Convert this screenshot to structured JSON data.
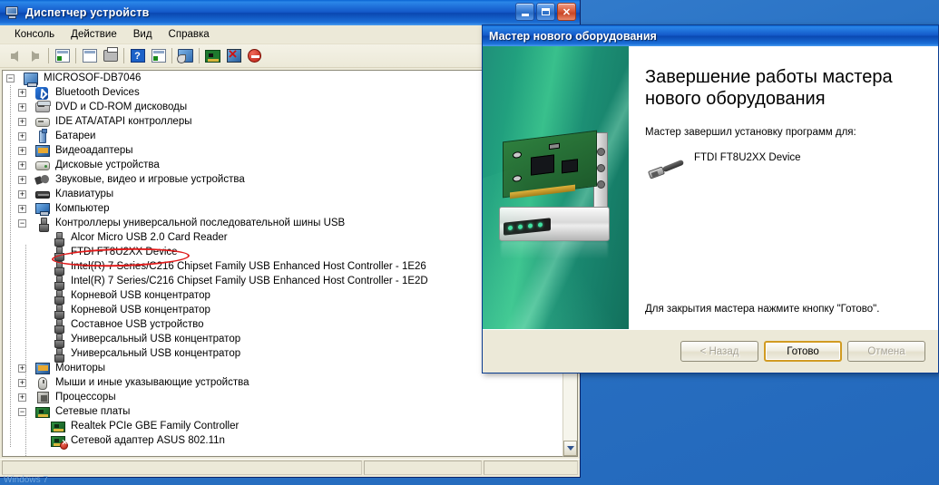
{
  "desktop": {
    "watermark": "Windows 7"
  },
  "device_manager": {
    "title": "Диспетчер устройств",
    "title_icon": "computer-icon",
    "window_buttons": {
      "minimize": "minimize-icon",
      "maximize": "maximize-icon",
      "close": "close-icon"
    },
    "menu": [
      "Консоль",
      "Действие",
      "Вид",
      "Справка"
    ],
    "toolbar": [
      {
        "name": "back-button",
        "icon": "left-arrow-icon"
      },
      {
        "name": "forward-button",
        "icon": "right-arrow-icon"
      },
      {
        "name": "show-hide-console-tree-button",
        "icon": "console-tree-icon"
      },
      {
        "name": "properties-button",
        "icon": "properties-icon"
      },
      {
        "name": "print-button",
        "icon": "printer-icon"
      },
      {
        "name": "help-button",
        "icon": "help-icon"
      },
      {
        "name": "view-button",
        "icon": "view-list-icon"
      },
      {
        "name": "scan-hardware-changes-button",
        "icon": "scan-hardware-icon"
      },
      {
        "name": "update-driver-button",
        "icon": "device-card-icon"
      },
      {
        "name": "uninstall-device-button",
        "icon": "uninstall-red-x-icon"
      },
      {
        "name": "disable-device-button",
        "icon": "disable-stop-icon"
      }
    ],
    "tree": [
      {
        "label": "MICROSOF-DB7046",
        "level": 0,
        "state": "expanded",
        "icon": "computer-icon"
      },
      {
        "label": "Bluetooth Devices",
        "level": 1,
        "state": "collapsed",
        "icon": "bluetooth-icon"
      },
      {
        "label": "DVD и CD-ROM дисководы",
        "level": 1,
        "state": "collapsed",
        "icon": "dvd-drive-icon"
      },
      {
        "label": "IDE ATA/ATAPI контроллеры",
        "level": 1,
        "state": "collapsed",
        "icon": "ide-controller-icon"
      },
      {
        "label": "Батареи",
        "level": 1,
        "state": "collapsed",
        "icon": "battery-icon"
      },
      {
        "label": "Видеоадаптеры",
        "level": 1,
        "state": "collapsed",
        "icon": "display-adapter-icon"
      },
      {
        "label": "Дисковые устройства",
        "level": 1,
        "state": "collapsed",
        "icon": "disk-drive-icon"
      },
      {
        "label": "Звуковые, видео и игровые устройства",
        "level": 1,
        "state": "collapsed",
        "icon": "sound-device-icon"
      },
      {
        "label": "Клавиатуры",
        "level": 1,
        "state": "collapsed",
        "icon": "keyboard-icon"
      },
      {
        "label": "Компьютер",
        "level": 1,
        "state": "collapsed",
        "icon": "computer-node-icon"
      },
      {
        "label": "Контроллеры универсальной последовательной шины USB",
        "level": 1,
        "state": "expanded",
        "icon": "usb-controller-icon"
      },
      {
        "label": "Alcor Micro USB 2.0 Card Reader",
        "level": 2,
        "state": "leaf",
        "icon": "usb-device-icon"
      },
      {
        "label": "FTDI FT8U2XX Device",
        "level": 2,
        "state": "leaf",
        "icon": "usb-device-icon",
        "annotated": true
      },
      {
        "label": "Intel(R) 7 Series/C216 Chipset Family USB Enhanced Host Controller - 1E26",
        "level": 2,
        "state": "leaf",
        "icon": "usb-device-icon"
      },
      {
        "label": "Intel(R) 7 Series/C216 Chipset Family USB Enhanced Host Controller - 1E2D",
        "level": 2,
        "state": "leaf",
        "icon": "usb-device-icon"
      },
      {
        "label": "Корневой USB концентратор",
        "level": 2,
        "state": "leaf",
        "icon": "usb-device-icon"
      },
      {
        "label": "Корневой USB концентратор",
        "level": 2,
        "state": "leaf",
        "icon": "usb-device-icon"
      },
      {
        "label": "Составное USB устройство",
        "level": 2,
        "state": "leaf",
        "icon": "usb-device-icon"
      },
      {
        "label": "Универсальный USB концентратор",
        "level": 2,
        "state": "leaf",
        "icon": "usb-device-icon"
      },
      {
        "label": "Универсальный USB концентратор",
        "level": 2,
        "state": "leaf",
        "icon": "usb-device-icon"
      },
      {
        "label": "Мониторы",
        "level": 1,
        "state": "collapsed",
        "icon": "monitor-icon"
      },
      {
        "label": "Мыши и иные указывающие устройства",
        "level": 1,
        "state": "collapsed",
        "icon": "mouse-icon"
      },
      {
        "label": "Процессоры",
        "level": 1,
        "state": "collapsed",
        "icon": "processor-icon"
      },
      {
        "label": "Сетевые платы",
        "level": 1,
        "state": "expanded",
        "icon": "network-adapter-icon"
      },
      {
        "label": "Realtek PCIe GBE Family Controller",
        "level": 2,
        "state": "leaf",
        "icon": "network-adapter-icon"
      },
      {
        "label": "Сетевой адаптер ASUS 802.11n",
        "level": 2,
        "state": "leaf",
        "icon": "network-adapter-disabled-icon"
      }
    ],
    "scrollbar": {
      "up_icon": "chevron-up-icon",
      "down_icon": "chevron-down-icon"
    },
    "statusbar": {
      "panel1": "",
      "panel2": "",
      "panel3": ""
    }
  },
  "wizard": {
    "title": "Мастер нового оборудования",
    "heading": "Завершение работы мастера нового оборудования",
    "subtitle": "Мастер завершил установку программ для:",
    "device_name": "FTDI FT8U2XX Device",
    "device_icon": "usb-cable-icon",
    "close_info": "Для закрытия мастера нажмите кнопку \"Готово\".",
    "buttons": {
      "back": "< Назад",
      "finish": "Готово",
      "cancel": "Отмена"
    }
  }
}
